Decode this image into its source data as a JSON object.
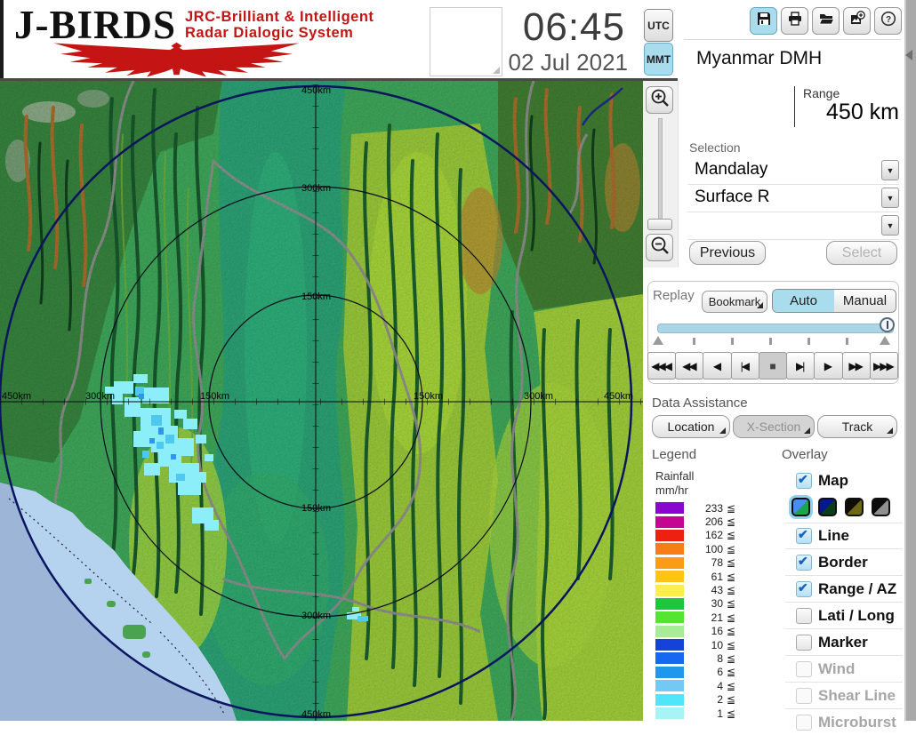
{
  "header": {
    "logo": {
      "title": "J-BIRDS",
      "subtitle_line1": "JRC-Brilliant & Intelligent",
      "subtitle_line2": "Radar  Dialogic  System"
    },
    "clock": {
      "time": "06:45",
      "date": "02 Jul 2021"
    },
    "timezone": {
      "items": [
        {
          "label": "UTC",
          "state": "normal"
        },
        {
          "label": "MMT",
          "state": "selected"
        }
      ]
    },
    "toolbar": {
      "items": [
        {
          "name": "save",
          "state": "selected"
        },
        {
          "name": "print",
          "state": "normal"
        },
        {
          "name": "open",
          "state": "normal"
        },
        {
          "name": "capture",
          "state": "normal"
        },
        {
          "name": "help",
          "state": "normal"
        }
      ]
    }
  },
  "panel": {
    "station": "Myanmar DMH",
    "range": {
      "label": "Range",
      "value": "450 km"
    },
    "selection": {
      "label": "Selection",
      "dropdowns": [
        "Mandalay",
        "Surface R",
        ""
      ],
      "previous_label": "Previous",
      "select_label": "Select",
      "select_state": "disabled"
    },
    "replay": {
      "label": "Replay",
      "bookmark_label": "Bookmark",
      "modes": [
        {
          "label": "Auto",
          "state": "selected"
        },
        {
          "label": "Manual",
          "state": "normal"
        }
      ],
      "playback": [
        {
          "name": "jump-to-start",
          "glyph": "◀◀◀",
          "state": "normal"
        },
        {
          "name": "fast-rewind",
          "glyph": "◀◀",
          "state": "normal"
        },
        {
          "name": "play-reverse",
          "glyph": "◀",
          "state": "normal"
        },
        {
          "name": "step-back",
          "glyph": "|◀",
          "state": "normal"
        },
        {
          "name": "stop",
          "glyph": "■",
          "state": "pressed"
        },
        {
          "name": "step-forward",
          "glyph": "▶|",
          "state": "normal"
        },
        {
          "name": "play",
          "glyph": "▶",
          "state": "normal"
        },
        {
          "name": "fast-forward",
          "glyph": "▶▶",
          "state": "normal"
        },
        {
          "name": "jump-to-end",
          "glyph": "▶▶▶",
          "state": "normal"
        }
      ]
    },
    "data_assistance": {
      "label": "Data Assistance",
      "buttons": [
        {
          "label": "Location",
          "state": "normal"
        },
        {
          "label": "X-Section",
          "state": "pressed"
        },
        {
          "label": "Track",
          "state": "normal"
        }
      ]
    },
    "legend": {
      "label": "Legend",
      "title_line1": "Rainfall",
      "title_line2": "mm/hr",
      "lte_symbol": "≦",
      "items": [
        {
          "value": "233",
          "color": "#8A06CE"
        },
        {
          "value": "206",
          "color": "#C40592"
        },
        {
          "value": "162",
          "color": "#EE2012"
        },
        {
          "value": "100",
          "color": "#F87D12"
        },
        {
          "value": "78",
          "color": "#FA9D16"
        },
        {
          "value": "61",
          "color": "#FFC414"
        },
        {
          "value": "43",
          "color": "#FBEE4E"
        },
        {
          "value": "30",
          "color": "#1EC63E"
        },
        {
          "value": "21",
          "color": "#55E42F"
        },
        {
          "value": "16",
          "color": "#A9EC97"
        },
        {
          "value": "10",
          "color": "#1542DB"
        },
        {
          "value": "8",
          "color": "#1568EF"
        },
        {
          "value": "6",
          "color": "#1F97EC"
        },
        {
          "value": "4",
          "color": "#74C9F2"
        },
        {
          "value": "2",
          "color": "#50E5F8"
        },
        {
          "value": "1",
          "color": "#A7F3F6"
        }
      ]
    },
    "overlay": {
      "label": "Overlay",
      "items": [
        {
          "label": "Map",
          "state": "checked"
        },
        {
          "label": "Line",
          "state": "checked"
        },
        {
          "label": "Border",
          "state": "checked"
        },
        {
          "label": "Range / AZ",
          "state": "checked"
        },
        {
          "label": "Lati / Long",
          "state": "unchecked"
        },
        {
          "label": "Marker",
          "state": "unchecked"
        },
        {
          "label": "Wind",
          "state": "disabled"
        },
        {
          "label": "Shear Line",
          "state": "disabled"
        },
        {
          "label": "Microburst",
          "state": "disabled"
        }
      ],
      "map_styles": [
        {
          "css": "linear-gradient(135deg,#4a8df0 50%,#1ca54a 50%)",
          "state": "selected"
        },
        {
          "css": "linear-gradient(135deg,#05188c 50%,#0d3d16 50%)",
          "state": "normal"
        },
        {
          "css": "linear-gradient(135deg,#0e0e06 50%,#6e6716 50%)",
          "state": "normal"
        },
        {
          "css": "linear-gradient(135deg,#0c0c0c 50%,#909090 50%)",
          "state": "normal"
        }
      ]
    }
  },
  "map": {
    "ring_labels": [
      "450km",
      "300km",
      "150km",
      "150km",
      "300km",
      "450km",
      "450km",
      "300km",
      "150km",
      "150km",
      "300km",
      "450km"
    ],
    "colors": {
      "rain_light": "#8CEEF8",
      "rain_mid": "#4FC8F0",
      "rain_dark": "#2F96E8",
      "ocean_inner": "#B5D2EE",
      "ocean_outer": "#9DB6D8",
      "ring": "#0A1560",
      "accent": "#A9DCEC"
    }
  }
}
